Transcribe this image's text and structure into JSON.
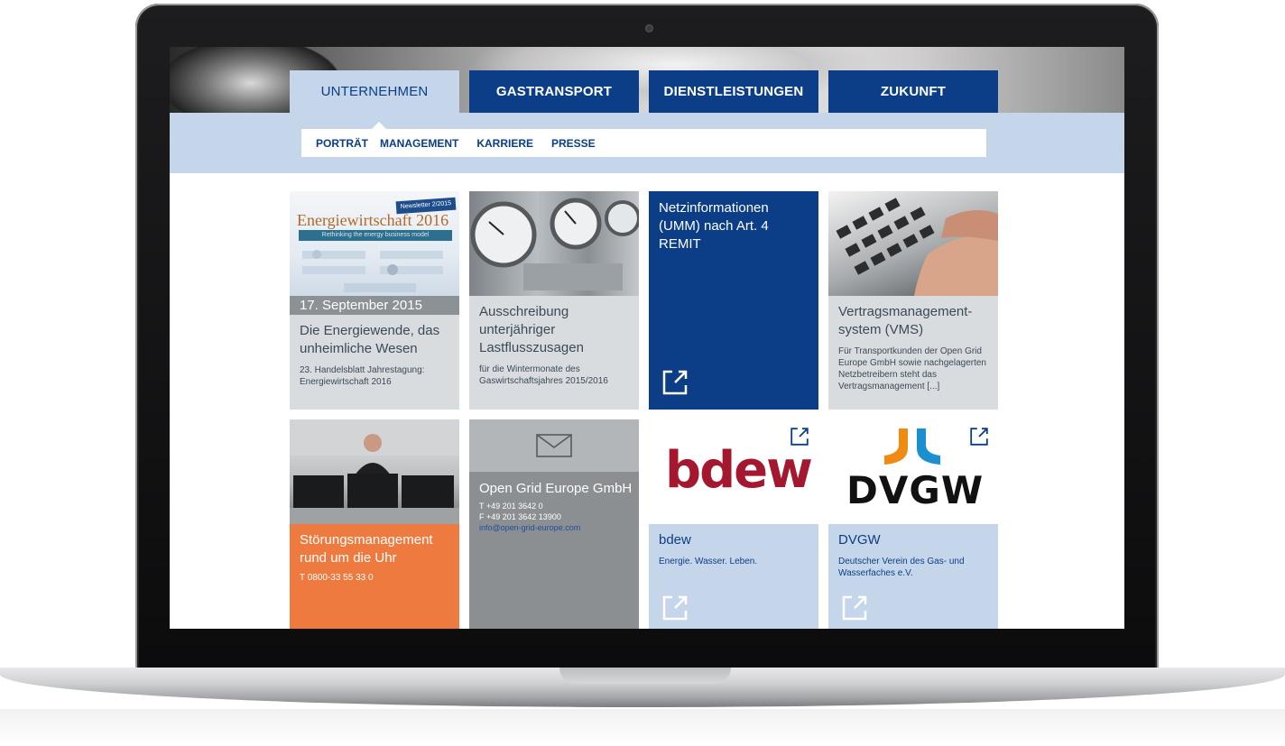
{
  "mainnav": {
    "tabs": [
      {
        "label": "UNTERNEHMEN",
        "active": true
      },
      {
        "label": "GASTRANSPORT",
        "active": false
      },
      {
        "label": "DIENSTLEISTUNGEN",
        "active": false
      },
      {
        "label": "ZUKUNFT",
        "active": false
      }
    ]
  },
  "subnav": {
    "items": [
      "PORTRÄT",
      "MANAGEMENT",
      "KARRIERE",
      "PRESSE"
    ]
  },
  "tiles": {
    "event": {
      "newsletter": "Newsletter 2/2015",
      "mag_title": "Energiewirtschaft 2016",
      "mag_sub": "Rethinking the energy business model",
      "date": "17. September 2015",
      "title": "Die Energiewende, das unheimliche Wesen",
      "text": "23. Handelsblatt Jahrestagung: Energiewirtschaft 2016"
    },
    "tender": {
      "title": "Ausschreibung unterjähriger Lastflusszusagen",
      "text": "für die Wintermonate des Gaswirtschaftsjahres 2015/2016"
    },
    "netz": {
      "title": "Netzinformationen (UMM) nach Art. 4 REMIT",
      "icon": "external-link-icon"
    },
    "vms": {
      "title": "Vertragsmanagement-system (VMS)",
      "text": "Für Transportkunden der Open Grid Europe GmbH sowie nachgelagerten Netzbetreibern steht das Vertragsmanagement [...]"
    },
    "stoerung": {
      "title": "Störungsmanagement rund um die Uhr",
      "text": "T 0800-33 55 33 0"
    },
    "contact": {
      "icon": "envelope-icon",
      "title": "Open Grid Europe GmbH",
      "phone": "T +49 201 3642 0",
      "fax": "F +49 201 3642 13900",
      "email": "info@open-grid-europe.com"
    },
    "bdew": {
      "logo": "bdew",
      "title": "bdew",
      "text": "Energie. Wasser. Leben."
    },
    "dvgw": {
      "logo": "DVGW",
      "title": "DVGW",
      "text": "Deutscher Verein des Gas- und Wasserfaches e.V."
    }
  },
  "colors": {
    "brand_blue": "#0b3e86",
    "light_blue": "#c6d6ea",
    "orange": "#ee7a3f",
    "grey_tile": "#d8dcdf",
    "dark_grey": "#8c8f92",
    "bdew_red": "#a3172f"
  }
}
